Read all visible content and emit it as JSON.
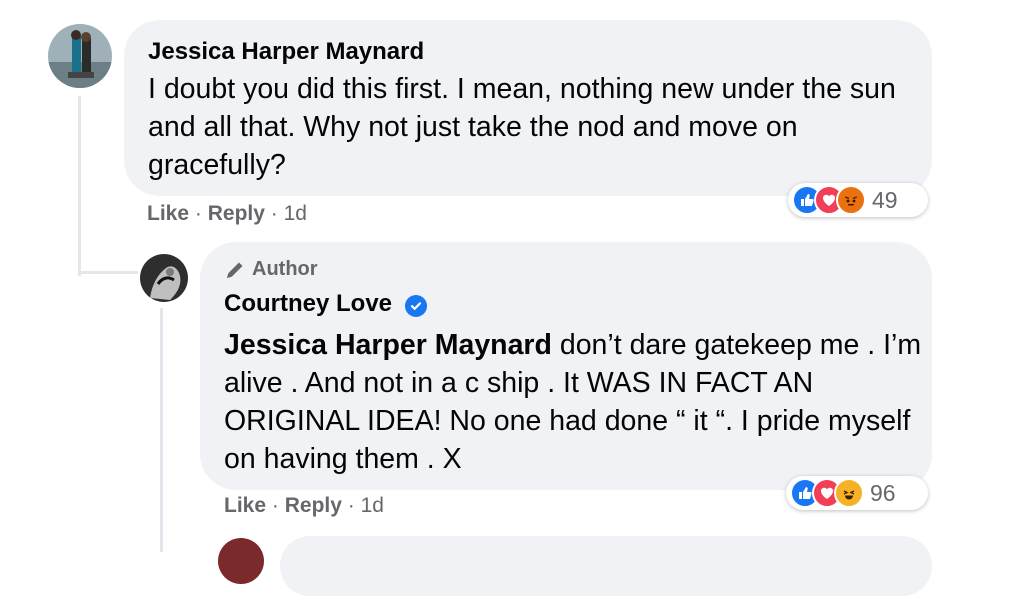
{
  "comments": [
    {
      "author": "Jessica Harper Maynard",
      "text": "I doubt you did this first. I mean, nothing new under the sun and all that. Why not just take the nod and move on gracefully?",
      "actions": {
        "like": "Like",
        "reply": "Reply",
        "sep": "·",
        "time": "1d"
      },
      "reaction_count": "49",
      "reaction_icons": [
        "like-icon",
        "love-icon",
        "angry-icon"
      ],
      "colors": {
        "like": "#1877f2",
        "love": "#f33e58",
        "angry": "#e9710f"
      }
    },
    {
      "badge": "Author",
      "author": "Courtney Love",
      "verified": true,
      "mention": "Jessica Harper Maynard",
      "text": " don’t dare gatekeep me . I’m alive . And not in a c ship . It WAS IN FACT AN ORIGINAL IDEA! No one had done “ it “. I pride myself on having them . X",
      "actions": {
        "like": "Like",
        "reply": "Reply",
        "sep": "·",
        "time": "1d"
      },
      "reaction_count": "96",
      "reaction_icons": [
        "like-icon",
        "love-icon",
        "haha-icon"
      ],
      "colors": {
        "like": "#1877f2",
        "love": "#f33e58",
        "haha": "#f7b125"
      }
    }
  ]
}
